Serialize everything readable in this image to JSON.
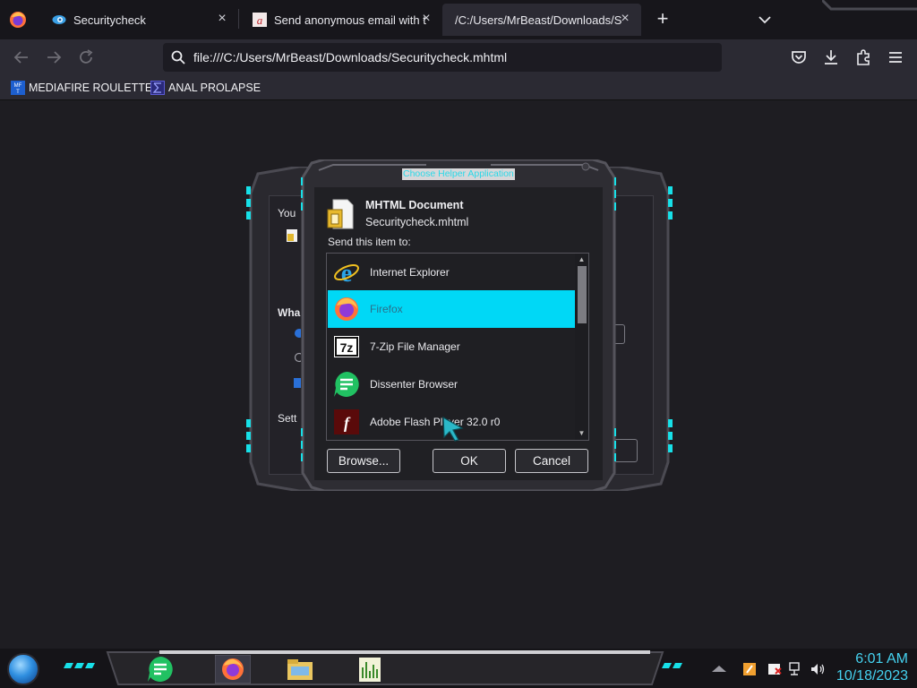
{
  "browser": {
    "tabs": [
      {
        "title": "Securitycheck",
        "icon": "camera-lens-icon"
      },
      {
        "title": "Send anonymous email with th",
        "icon": "anonymous-a-icon"
      },
      {
        "title": "/C:/Users/MrBeast/Downloads/Secu",
        "active": true
      }
    ],
    "url": "file:///C:/Users/MrBeast/Downloads/Securitycheck.mhtml",
    "bookmarks": [
      {
        "label": "MEDIAFIRE ROULETTER",
        "icon": "mediafire-icon"
      },
      {
        "label": "ANAL PROLAPSE",
        "icon": "sigma-icon"
      }
    ]
  },
  "background_dialog": {
    "line1": "You",
    "line2": "Wha",
    "line3": "Sett"
  },
  "dialog": {
    "title": "Choose Helper Application",
    "document_type": "MHTML Document",
    "file_name": "Securitycheck.mhtml",
    "send_label": "Send this item to:",
    "apps": [
      {
        "label": "Internet Explorer",
        "icon": "internet-explorer-icon"
      },
      {
        "label": "Firefox",
        "icon": "firefox-icon",
        "selected": true
      },
      {
        "label": "7-Zip File Manager",
        "icon": "7zip-icon"
      },
      {
        "label": "Dissenter Browser",
        "icon": "dissenter-icon"
      },
      {
        "label": "Adobe Flash Player 32.0 r0",
        "icon": "flash-player-icon"
      }
    ],
    "buttons": {
      "browse": "Browse...",
      "ok": "OK",
      "cancel": "Cancel"
    }
  },
  "taskbar": {
    "apps": [
      "dissenter-icon",
      "firefox-icon",
      "file-explorer-icon",
      "audio-app-icon"
    ],
    "clock_time": "6:01 AM",
    "clock_date": "10/18/2023"
  },
  "colors": {
    "accent_cyan": "#00d8f6",
    "clock": "#45d2f0",
    "frame_teal": "#17e0e8"
  }
}
